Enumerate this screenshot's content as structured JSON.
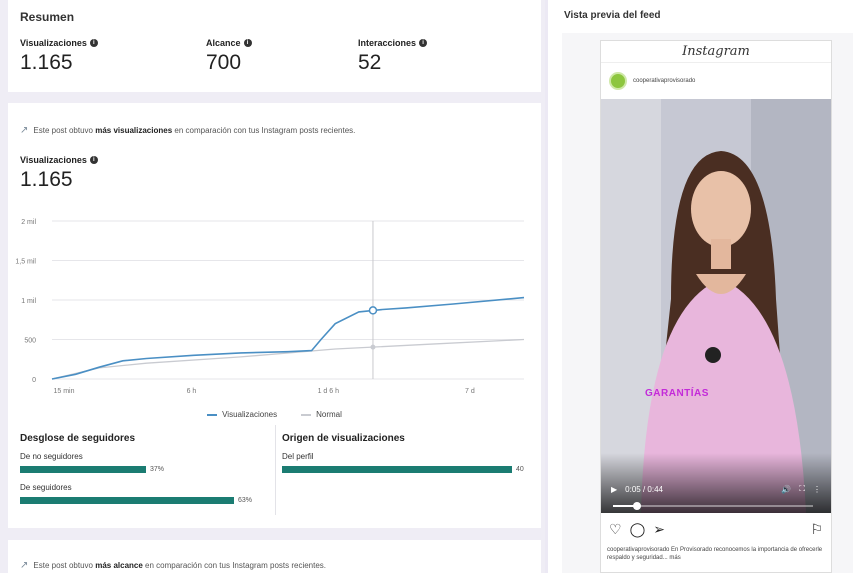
{
  "summary": {
    "title": "Resumen",
    "metrics": [
      {
        "label": "Visualizaciones",
        "value": "1.165"
      },
      {
        "label": "Alcance",
        "value": "700"
      },
      {
        "label": "Interacciones",
        "value": "52"
      }
    ]
  },
  "insights": {
    "views_prefix": "Este post obtuvo ",
    "views_bold": "más visualizaciones",
    "views_suffix": " en comparación con tus Instagram posts recientes.",
    "reach_prefix": "Este post obtuvo ",
    "reach_bold": "más alcance",
    "reach_suffix": " en comparación con tus Instagram posts recientes."
  },
  "views_chart": {
    "label": "Visualizaciones",
    "value": "1.165",
    "legend": {
      "series": "Visualizaciones",
      "normal": "Normal"
    }
  },
  "chart_data": {
    "type": "line",
    "x_tick_labels": [
      "15 min",
      "6 h",
      "1 d 6 h",
      "7 d"
    ],
    "y_tick_labels": [
      "0",
      "500",
      "1 mil",
      "1,5 mil",
      "2 mil"
    ],
    "ylim": [
      0,
      2000
    ],
    "series": [
      {
        "name": "Visualizaciones",
        "color": "#4a8fc4",
        "points": [
          [
            0,
            0
          ],
          [
            0.05,
            60
          ],
          [
            0.1,
            150
          ],
          [
            0.15,
            230
          ],
          [
            0.2,
            260
          ],
          [
            0.3,
            300
          ],
          [
            0.4,
            330
          ],
          [
            0.5,
            345
          ],
          [
            0.55,
            360
          ],
          [
            0.57,
            500
          ],
          [
            0.6,
            700
          ],
          [
            0.65,
            850
          ],
          [
            0.7,
            880
          ],
          [
            0.75,
            900
          ],
          [
            0.85,
            950
          ],
          [
            1.0,
            1030
          ]
        ]
      },
      {
        "name": "Normal",
        "color": "#c9cbd1",
        "points": [
          [
            0,
            0
          ],
          [
            0.1,
            140
          ],
          [
            0.2,
            200
          ],
          [
            0.4,
            280
          ],
          [
            0.6,
            380
          ],
          [
            0.8,
            440
          ],
          [
            1.0,
            500
          ]
        ]
      }
    ],
    "highlight_x": 0.68,
    "grid": true,
    "legend_position": "bottom"
  },
  "followers": {
    "title": "Desglose de seguidores",
    "rows": [
      {
        "label": "De no seguidores",
        "pct": "37%",
        "fraction": 0.37
      },
      {
        "label": "De seguidores",
        "pct": "63%",
        "fraction": 0.63
      }
    ]
  },
  "origins": {
    "title": "Origen de visualizaciones",
    "rows": [
      {
        "label": "Del perfil",
        "value": "40",
        "fraction": 1.0
      }
    ]
  },
  "preview": {
    "title": "Vista previa del feed",
    "app_name": "Instagram",
    "handle": "cooperativaprovisorado",
    "banner_prefix": "",
    "banner_highlight": "GARANTÍAS",
    "banner_suffix": "",
    "time": "0:05 / 0:44",
    "progress_fraction": 0.12,
    "caption": "cooperativaprovisorado En Provisorado reconocemos la importancia de ofrecerle respaldo y seguridad... más"
  }
}
